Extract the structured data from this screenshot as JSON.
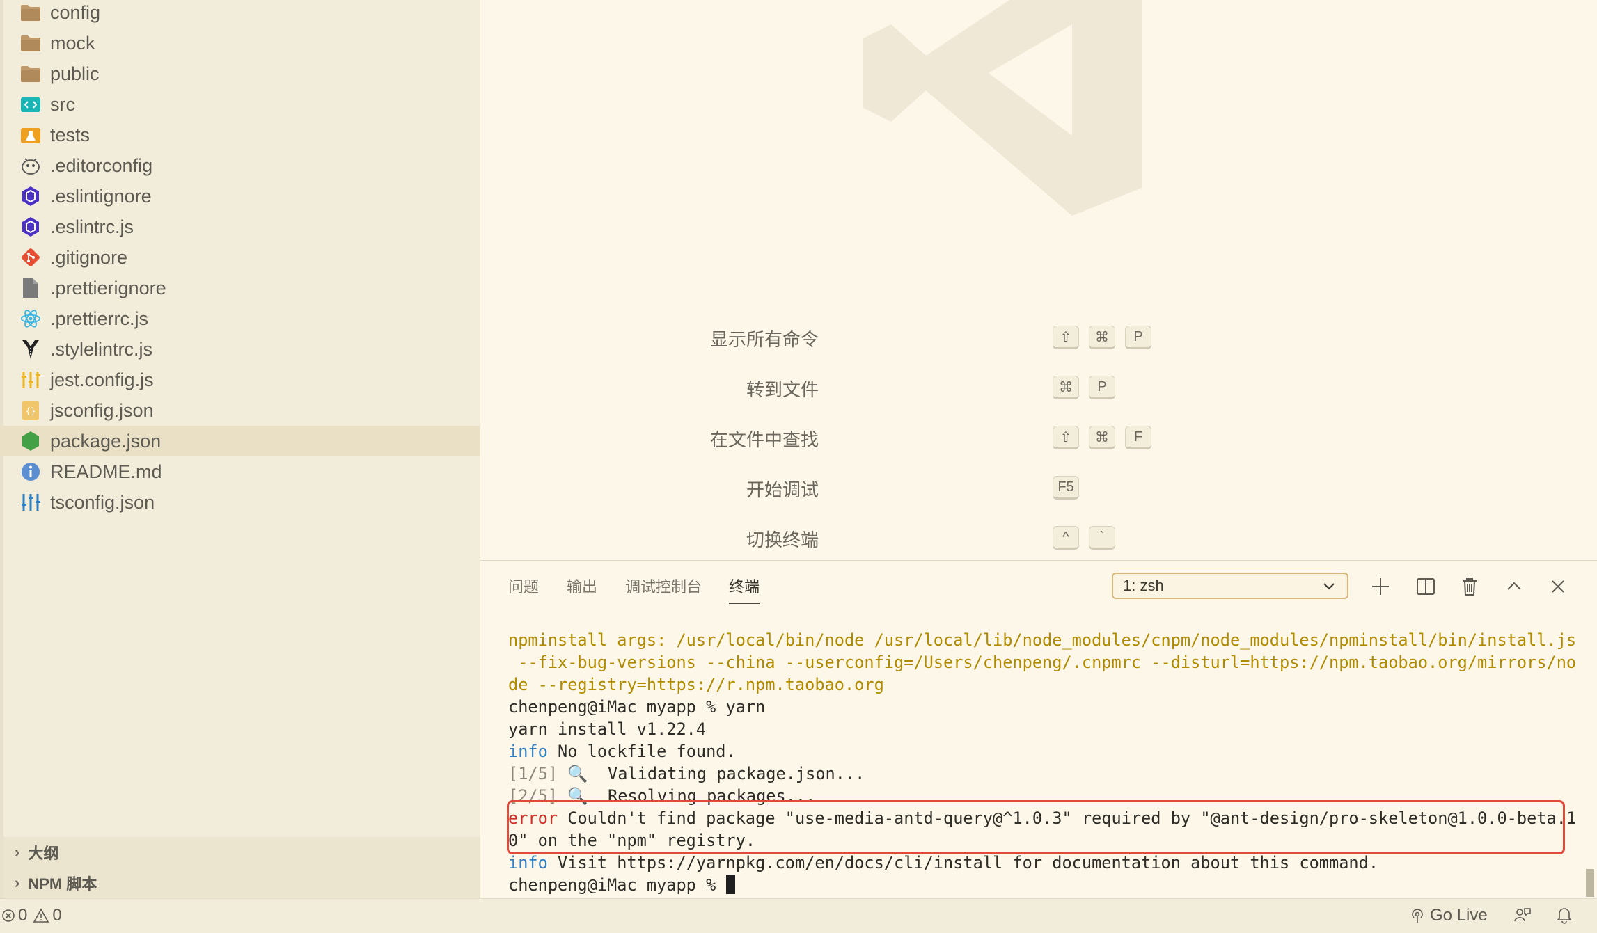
{
  "explorer": {
    "files": [
      {
        "label": "config",
        "icon": "folder-icon"
      },
      {
        "label": "mock",
        "icon": "folder-icon"
      },
      {
        "label": "public",
        "icon": "folder-icon"
      },
      {
        "label": "src",
        "icon": "src-folder-icon"
      },
      {
        "label": "tests",
        "icon": "tests-folder-icon"
      },
      {
        "label": ".editorconfig",
        "icon": "editorconfig-icon"
      },
      {
        "label": ".eslintignore",
        "icon": "eslint-icon"
      },
      {
        "label": ".eslintrc.js",
        "icon": "eslint-icon"
      },
      {
        "label": ".gitignore",
        "icon": "git-icon"
      },
      {
        "label": ".prettierignore",
        "icon": "file-icon"
      },
      {
        "label": ".prettierrc.js",
        "icon": "react-icon"
      },
      {
        "label": ".stylelintrc.js",
        "icon": "stylelint-icon"
      },
      {
        "label": "jest.config.js",
        "icon": "jest-icon"
      },
      {
        "label": "jsconfig.json",
        "icon": "json-icon"
      },
      {
        "label": "package.json",
        "icon": "nodejs-icon"
      },
      {
        "label": "README.md",
        "icon": "info-icon"
      },
      {
        "label": "tsconfig.json",
        "icon": "tsconfig-icon"
      }
    ],
    "selected": "package.json",
    "sections": [
      {
        "label": "大纲"
      },
      {
        "label": "NPM 脚本"
      }
    ]
  },
  "welcome": {
    "shortcuts": [
      {
        "label": "显示所有命令",
        "keys": [
          "⇧",
          "⌘",
          "P"
        ]
      },
      {
        "label": "转到文件",
        "keys": [
          "⌘",
          "P"
        ]
      },
      {
        "label": "在文件中查找",
        "keys": [
          "⇧",
          "⌘",
          "F"
        ]
      },
      {
        "label": "开始调试",
        "keys": [
          "F5"
        ]
      },
      {
        "label": "切换终端",
        "keys": [
          "^",
          "`"
        ]
      }
    ]
  },
  "panel": {
    "tabs": [
      "问题",
      "输出",
      "调试控制台",
      "终端"
    ],
    "active_tab": "终端",
    "terminal_select": "1: zsh"
  },
  "terminal": {
    "lines": [
      {
        "parts": [
          {
            "text": "npminstall args: /usr/local/bin/node /usr/local/lib/node_modules/cnpm/node_modules/npminstall/bin/install.js",
            "color": "yellow"
          }
        ]
      },
      {
        "parts": [
          {
            "text": " --fix-bug-versions --china --userconfig=/Users/chenpeng/.cnpmrc --disturl=https://npm.taobao.org/mirrors/no",
            "color": "yellow"
          }
        ]
      },
      {
        "parts": [
          {
            "text": "de --registry=https://r.npm.taobao.org",
            "color": "yellow"
          }
        ]
      },
      {
        "parts": [
          {
            "text": "chenpeng@iMac myapp % yarn",
            "color": "default"
          }
        ]
      },
      {
        "parts": [
          {
            "text": "yarn install v1.22.4",
            "color": "default"
          }
        ]
      },
      {
        "parts": [
          {
            "text": "info",
            "color": "blue"
          },
          {
            "text": " No lockfile found.",
            "color": "default"
          }
        ]
      },
      {
        "parts": [
          {
            "text": "[1/5]",
            "color": "gray"
          },
          {
            "text": " 🔍  Validating package.json...",
            "color": "default"
          }
        ]
      },
      {
        "parts": [
          {
            "text": "[2/5]",
            "color": "gray"
          },
          {
            "text": " 🔍  Resolving packages...",
            "color": "default"
          }
        ]
      },
      {
        "parts": [
          {
            "text": "error",
            "color": "red"
          },
          {
            "text": " Couldn't find package \"use-media-antd-query@^1.0.3\" required by \"@ant-design/pro-skeleton@1.0.0-beta.1",
            "color": "default"
          }
        ]
      },
      {
        "parts": [
          {
            "text": "0\" on the \"npm\" registry.",
            "color": "default"
          }
        ]
      },
      {
        "parts": [
          {
            "text": "info",
            "color": "blue"
          },
          {
            "text": " Visit https://yarnpkg.com/en/docs/cli/install for documentation about this command.",
            "color": "default"
          }
        ]
      },
      {
        "parts": [
          {
            "text": "chenpeng@iMac myapp % ",
            "color": "default"
          }
        ],
        "cursor": true
      }
    ]
  },
  "statusbar": {
    "errors": "0",
    "warnings": "0",
    "go_live": "Go Live"
  }
}
